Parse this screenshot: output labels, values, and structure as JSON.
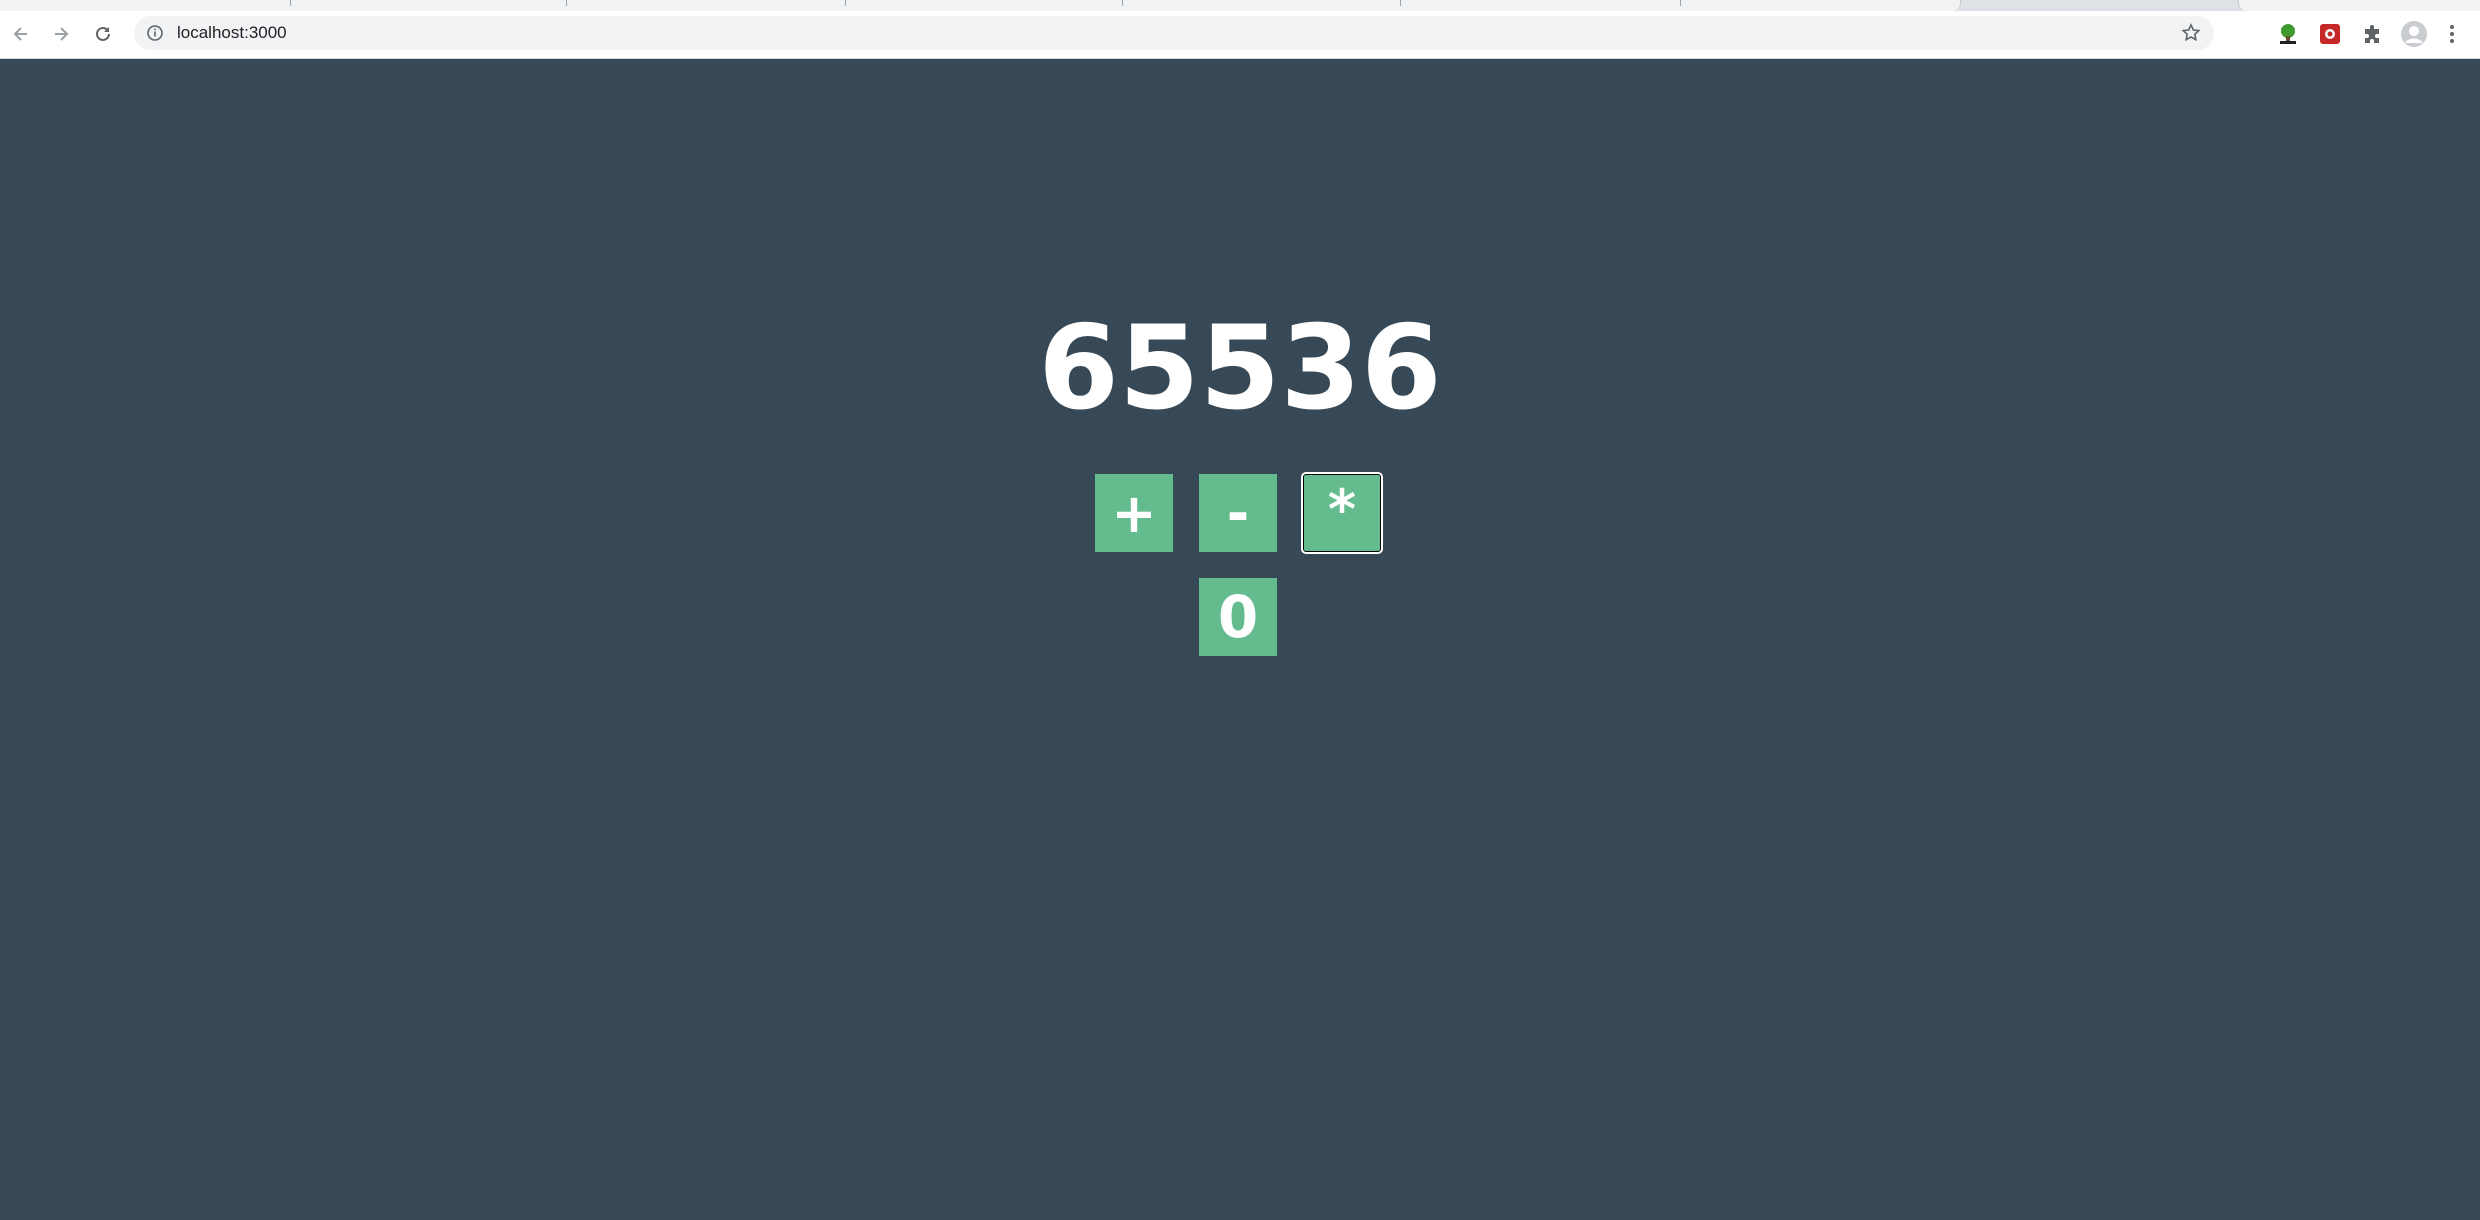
{
  "browser": {
    "url": "localhost:3000",
    "icons": {
      "back": "arrow-left-icon",
      "forward": "arrow-right-icon",
      "reload": "reload-icon",
      "site_info": "info-icon",
      "bookmark": "star-icon",
      "extension_1": "tree-extension-icon",
      "extension_2": "red-extension-icon",
      "extensions": "puzzle-icon",
      "profile": "avatar-icon",
      "menu": "kebab-menu-icon"
    }
  },
  "app": {
    "value": "65536",
    "buttons": {
      "add": "+",
      "subtract": "-",
      "multiply": "*",
      "reset": "0"
    },
    "colors": {
      "background": "#374956",
      "button": "#64bc8e",
      "text": "#ffffff"
    }
  }
}
